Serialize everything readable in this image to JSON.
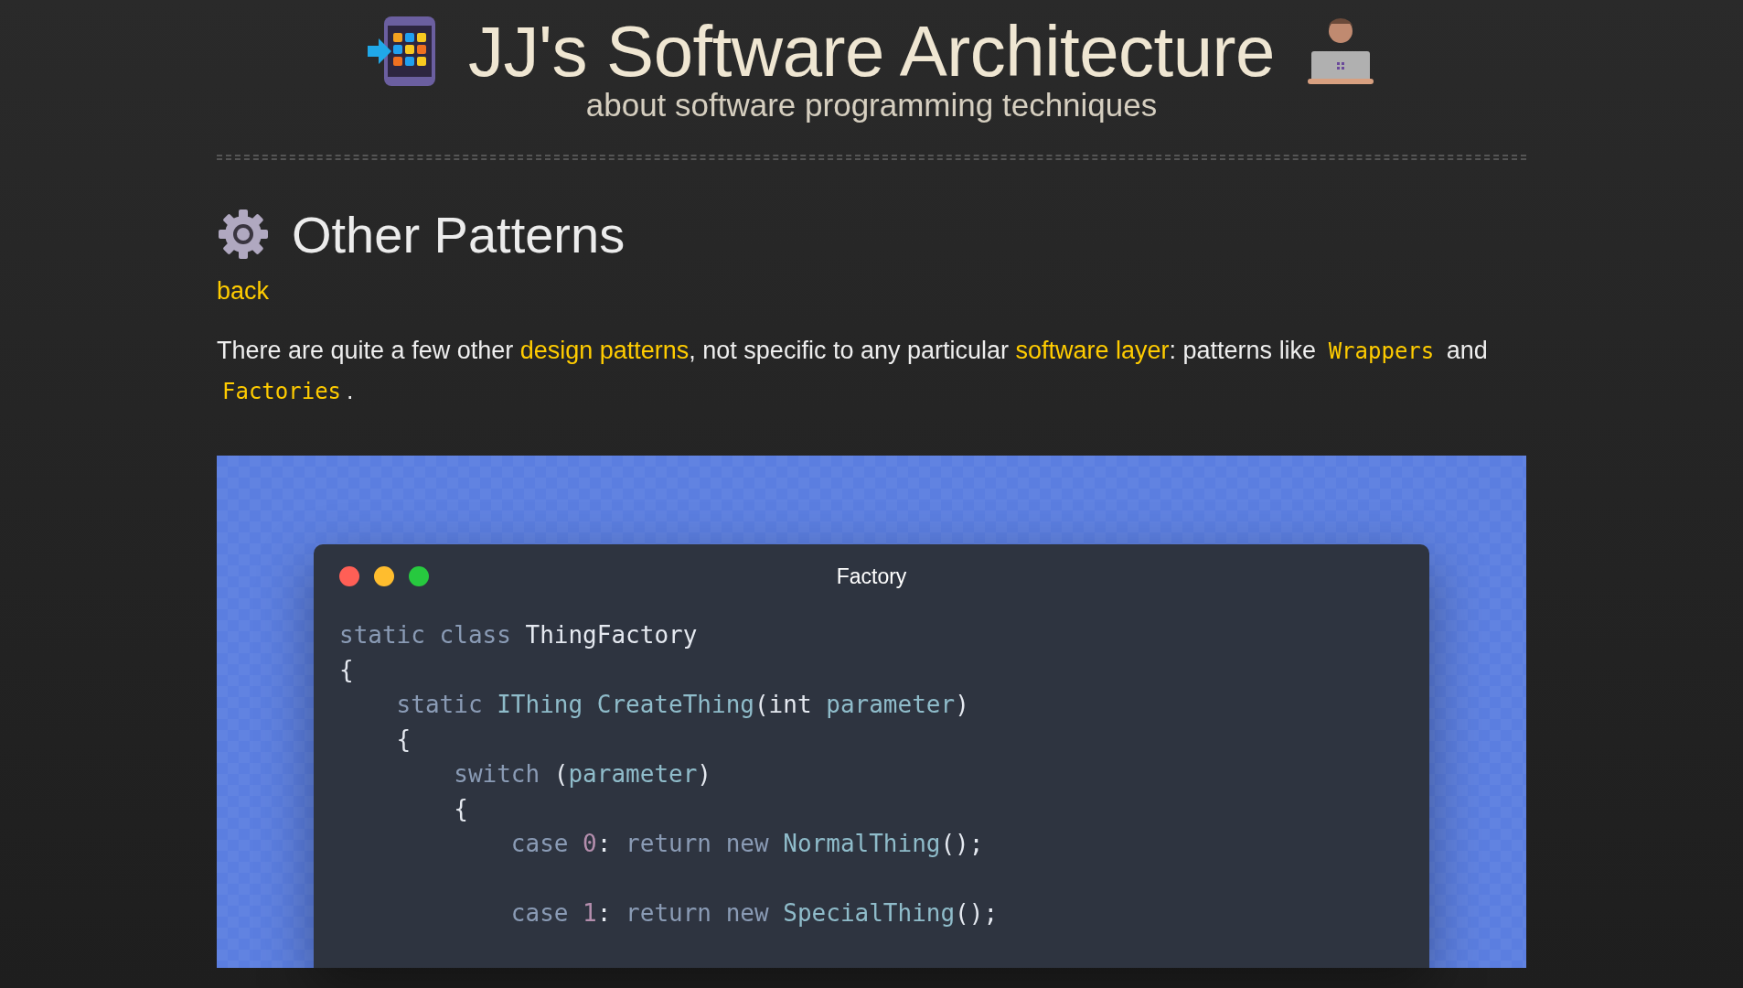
{
  "header": {
    "title": "JJ's Software Architecture",
    "subtitle": "about software programming techniques"
  },
  "page": {
    "heading": "Other Patterns",
    "back_link": "back",
    "intro": [
      {
        "kind": "text",
        "text": "There are quite a few other "
      },
      {
        "kind": "link",
        "text": "design patterns"
      },
      {
        "kind": "text",
        "text": ", not specific to any particular "
      },
      {
        "kind": "link",
        "text": "software layer"
      },
      {
        "kind": "text",
        "text": ": patterns like "
      },
      {
        "kind": "code",
        "text": "Wrappers"
      },
      {
        "kind": "text",
        "text": " and "
      },
      {
        "kind": "code",
        "text": "Factories"
      },
      {
        "kind": "text",
        "text": "."
      }
    ]
  },
  "code_window": {
    "title": "Factory",
    "lines": [
      {
        "kind": "code",
        "tokens": [
          {
            "kind": "keyword",
            "text": "static class "
          },
          {
            "kind": "plain",
            "text": "ThingFactory"
          }
        ]
      },
      {
        "kind": "code",
        "tokens": [
          {
            "kind": "plain",
            "text": "{"
          }
        ]
      },
      {
        "kind": "code",
        "tokens": [
          {
            "kind": "keyword",
            "text": "    static "
          },
          {
            "kind": "type",
            "text": "IThing CreateThing"
          },
          {
            "kind": "plain",
            "text": "(int "
          },
          {
            "kind": "type",
            "text": "parameter"
          },
          {
            "kind": "plain",
            "text": ")"
          }
        ]
      },
      {
        "kind": "code",
        "tokens": [
          {
            "kind": "plain",
            "text": "    {"
          }
        ]
      },
      {
        "kind": "code",
        "tokens": [
          {
            "kind": "keyword",
            "text": "        switch "
          },
          {
            "kind": "plain",
            "text": "("
          },
          {
            "kind": "type",
            "text": "parameter"
          },
          {
            "kind": "plain",
            "text": ")"
          }
        ]
      },
      {
        "kind": "code",
        "tokens": [
          {
            "kind": "plain",
            "text": "        {"
          }
        ]
      },
      {
        "kind": "code",
        "tokens": [
          {
            "kind": "keyword",
            "text": "            case "
          },
          {
            "kind": "number",
            "text": "0"
          },
          {
            "kind": "plain",
            "text": ": "
          },
          {
            "kind": "keyword",
            "text": "return new "
          },
          {
            "kind": "type",
            "text": "NormalThing"
          },
          {
            "kind": "plain",
            "text": "();"
          }
        ]
      },
      {
        "kind": "blank"
      },
      {
        "kind": "code",
        "tokens": [
          {
            "kind": "keyword",
            "text": "            case "
          },
          {
            "kind": "number",
            "text": "1"
          },
          {
            "kind": "plain",
            "text": ": "
          },
          {
            "kind": "keyword",
            "text": "return new "
          },
          {
            "kind": "type",
            "text": "SpecialThing"
          },
          {
            "kind": "plain",
            "text": "();"
          }
        ]
      }
    ]
  }
}
